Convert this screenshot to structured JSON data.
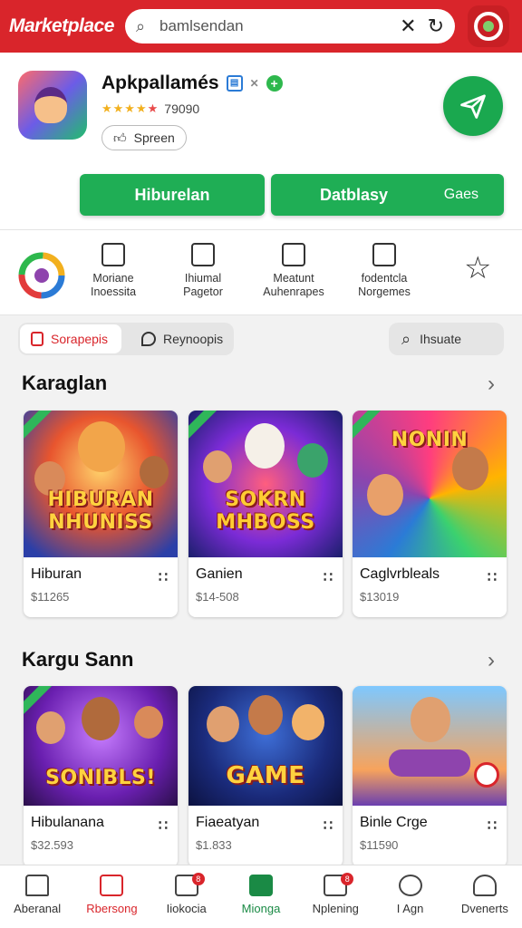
{
  "header": {
    "brand": "Marketplace",
    "search_value": "bamlsendan",
    "search_placeholder": "bamlsendan"
  },
  "app": {
    "title": "Apkpallamés",
    "rating_count": "79090",
    "share_label": "Spreen",
    "buttons": {
      "primary": "Hiburelan",
      "secondary": "Datblasy",
      "secondary_extra": "Gaes"
    }
  },
  "categories": [
    {
      "line1": "Moriane",
      "line2": "Inoessita"
    },
    {
      "line1": "Ihiumal",
      "line2": "Pagetor"
    },
    {
      "line1": "Meatunt",
      "line2": "Auhenrapes"
    },
    {
      "line1": "fodentcla",
      "line2": "Norgemes"
    }
  ],
  "filters": {
    "active": "Sorapepis",
    "inactive": "Reynoopis",
    "find": "Ihsuate"
  },
  "sections": [
    {
      "title": "Karaglan",
      "cards": [
        {
          "name": "Hiburan",
          "price": "$11265",
          "art_text": "HIBURAN NHUNISS"
        },
        {
          "name": "Ganien",
          "price": "$14-508",
          "art_text": "SOKRN MHBOSS"
        },
        {
          "name": "Caglvrbleals",
          "price": "$13019",
          "art_text": "NONIN"
        }
      ]
    },
    {
      "title": "Kargu Sann",
      "cards": [
        {
          "name": "Hibulanana",
          "price": "$32.593",
          "art_text": "SONIBLS!"
        },
        {
          "name": "Fiaeatyan",
          "price": "$1.833",
          "art_text": "GAME"
        },
        {
          "name": "Binle Crge",
          "price": "$11590",
          "art_text": ""
        }
      ]
    }
  ],
  "bottom_nav": [
    {
      "label": "Aberanal",
      "badge": ""
    },
    {
      "label": "Rbersong",
      "badge": ""
    },
    {
      "label": "Iiokocia",
      "badge": "8"
    },
    {
      "label": "Mionga",
      "badge": ""
    },
    {
      "label": "Nplening",
      "badge": "8"
    },
    {
      "label": "I Agn",
      "badge": ""
    },
    {
      "label": "Dvenerts",
      "badge": ""
    }
  ],
  "colors": {
    "brand_red": "#d9252b",
    "primary_green": "#1fae55",
    "star_gold": "#f2b01e"
  }
}
